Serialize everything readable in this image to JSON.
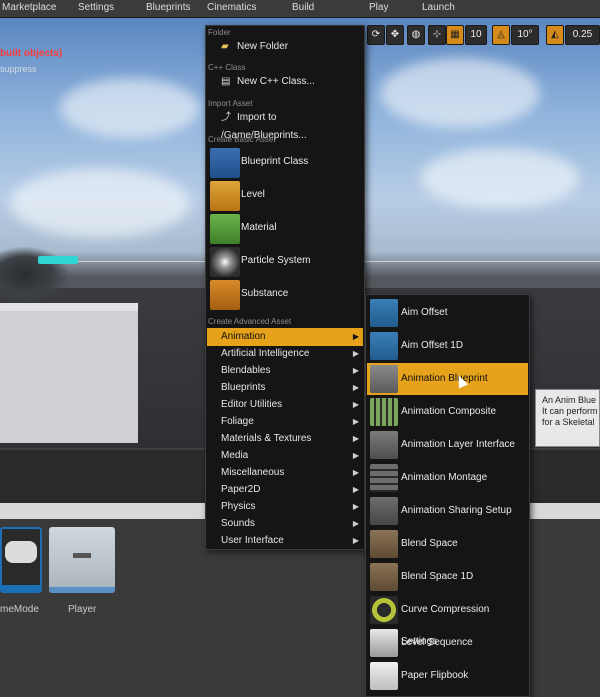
{
  "toolbar": {
    "items": [
      "Marketplace",
      "Settings",
      "Blueprints",
      "Cinematics",
      "Build",
      "Play",
      "Launch"
    ]
  },
  "viewport": {
    "warning_text": "built objects)",
    "warning_sub": "suppress",
    "snap_values": [
      "10",
      "10°",
      "0.25"
    ]
  },
  "main_menu": {
    "sections": {
      "folder": "Folder",
      "cpp": "C++ Class",
      "import": "Import Asset",
      "basic": "Create Basic Asset",
      "advanced": "Create Advanced Asset"
    },
    "new_folder": "New Folder",
    "new_cpp": "New C++ Class...",
    "import_to": "Import to /Game/Blueprints...",
    "basic_assets": [
      "Blueprint Class",
      "Level",
      "Material",
      "Particle System",
      "Substance"
    ],
    "advanced_items": [
      "Animation",
      "Artificial Intelligence",
      "Blendables",
      "Blueprints",
      "Editor Utilities",
      "Foliage",
      "Materials & Textures",
      "Media",
      "Miscellaneous",
      "Paper2D",
      "Physics",
      "Sounds",
      "User Interface"
    ]
  },
  "submenu": {
    "items": [
      "Aim Offset",
      "Aim Offset 1D",
      "Animation Blueprint",
      "Animation Composite",
      "Animation Layer Interface",
      "Animation Montage",
      "Animation Sharing Setup",
      "Blend Space",
      "Blend Space 1D",
      "Curve Compression Settings",
      "Level Sequence",
      "Paper Flipbook"
    ],
    "active_index": 2
  },
  "tooltip": {
    "lines": [
      "An Anim Blue",
      "It can perform",
      "for a Skeletal"
    ]
  },
  "content_browser": {
    "tiles": [
      "meMode",
      "Player"
    ]
  },
  "colors": {
    "accent": "#e6a21a",
    "menu_bg": "#151515"
  }
}
